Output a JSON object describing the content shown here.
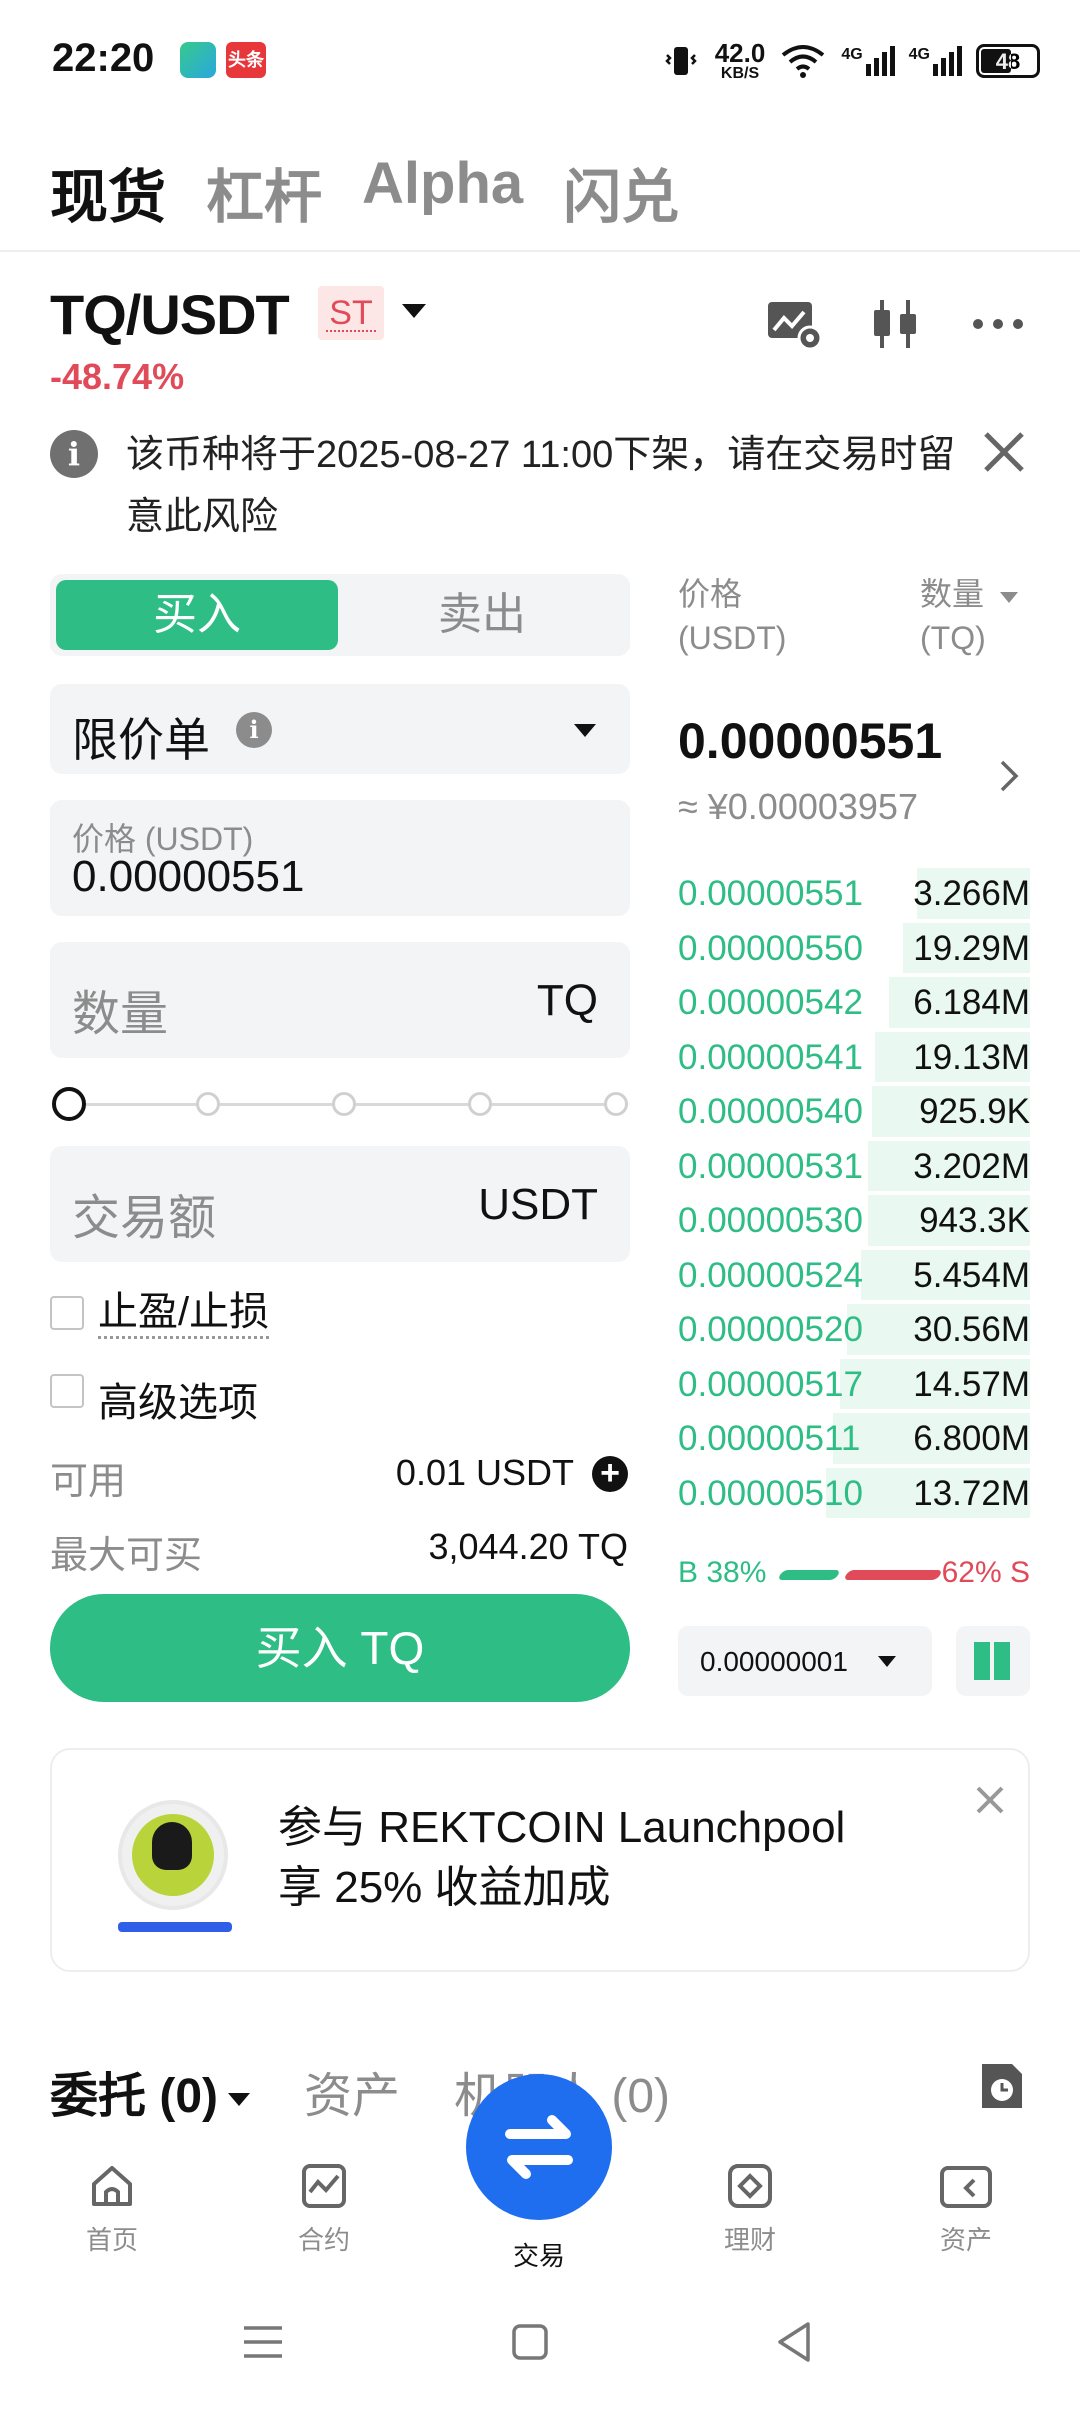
{
  "status_bar": {
    "time": "22:20",
    "net_speed": "42.0",
    "net_unit": "KB/S",
    "signal1": "4G",
    "signal2": "4G",
    "battery": "48",
    "app_badge": "头条"
  },
  "top_tabs": [
    "现货",
    "杠杆",
    "Alpha",
    "闪兑"
  ],
  "pair": {
    "symbol": "TQ/USDT",
    "badge": "ST",
    "change": "-48.74%"
  },
  "notice": {
    "text": "该币种将于2025-08-27 11:00下架，请在交易时留意此风险"
  },
  "order": {
    "buy_tab": "买入",
    "sell_tab": "卖出",
    "order_type": "限价单",
    "price_label": "价格 (USDT)",
    "price_value": "0.00000551",
    "qty_placeholder": "数量",
    "qty_unit": "TQ",
    "slider_value_pct": 0,
    "amount_placeholder": "交易额",
    "amount_unit": "USDT",
    "tpsl_label": "止盈/止损",
    "advanced_label": "高级选项",
    "available_label": "可用",
    "available_value": "0.01 USDT",
    "max_buy_label": "最大可买",
    "max_buy_value": "3,044.20 TQ",
    "buy_button": "买入 TQ"
  },
  "order_book": {
    "price_header_1": "价格",
    "price_header_2": "(USDT)",
    "qty_header_1": "数量",
    "qty_header_2": "(TQ)",
    "last_price": "0.00000551",
    "last_price_cny": "≈ ¥0.00003957",
    "rows": [
      {
        "price": "0.00000551",
        "qty": "3.266M",
        "depth": 0.32
      },
      {
        "price": "0.00000550",
        "qty": "19.29M",
        "depth": 0.36
      },
      {
        "price": "0.00000542",
        "qty": "6.184M",
        "depth": 0.4
      },
      {
        "price": "0.00000541",
        "qty": "19.13M",
        "depth": 0.44
      },
      {
        "price": "0.00000540",
        "qty": "925.9K",
        "depth": 0.45
      },
      {
        "price": "0.00000531",
        "qty": "3.202M",
        "depth": 0.46
      },
      {
        "price": "0.00000530",
        "qty": "943.3K",
        "depth": 0.46
      },
      {
        "price": "0.00000524",
        "qty": "5.454M",
        "depth": 0.48
      },
      {
        "price": "0.00000520",
        "qty": "30.56M",
        "depth": 0.52
      },
      {
        "price": "0.00000517",
        "qty": "14.57M",
        "depth": 0.54
      },
      {
        "price": "0.00000511",
        "qty": "6.800M",
        "depth": 0.56
      },
      {
        "price": "0.00000510",
        "qty": "13.72M",
        "depth": 0.58
      }
    ],
    "buy_ratio": "B 38%",
    "sell_ratio": "62% S",
    "precision": "0.00000001"
  },
  "promo": {
    "line1": "参与 REKTCOIN Launchpool",
    "line2": "享 25% 收益加成"
  },
  "bottom_tabs": {
    "orders": "委托 (0)",
    "assets": "资产",
    "bots": "机器人 (0)"
  },
  "nav": {
    "home": "首页",
    "futures": "合约",
    "trade": "交易",
    "earn": "理财",
    "assets": "资产"
  },
  "colors": {
    "green": "#2ebd85",
    "red": "#e04a59",
    "blue_fab": "#1f6ef0"
  }
}
